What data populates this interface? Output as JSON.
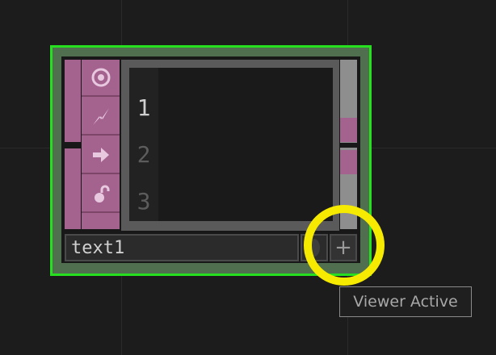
{
  "node": {
    "name": "text1",
    "line_numbers": [
      "1",
      "2",
      "3"
    ],
    "active_line": "1",
    "flag_icons": [
      "target-icon",
      "lightning-icon",
      "arrow-right-icon",
      "lock-icon"
    ],
    "add_symbol": "+"
  },
  "tooltip": {
    "text": "Viewer Active"
  },
  "colors": {
    "selection": "#26e01f",
    "operator": "#a4628f",
    "highlight": "#f5ea00",
    "background": "#1c1c1c"
  }
}
